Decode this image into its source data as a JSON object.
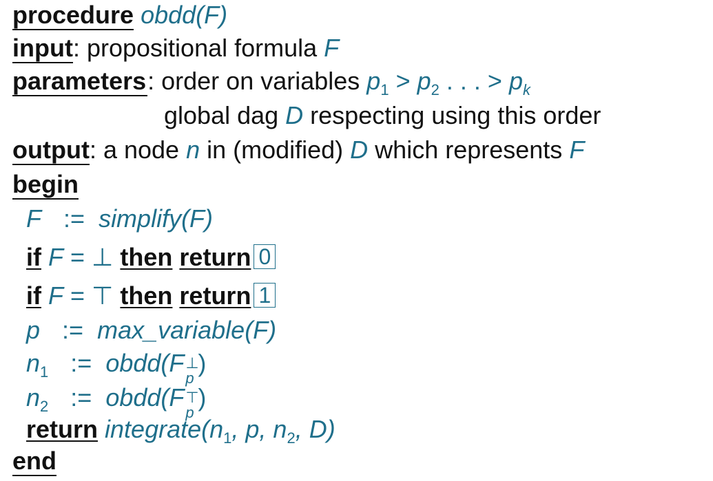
{
  "header": {
    "procedure_kw": "procedure",
    "procedure_name": "obdd(F)"
  },
  "input": {
    "label": "input",
    "text": ": propositional formula ",
    "var": "F"
  },
  "parameters": {
    "label": "parameters",
    "text": ": order on variables ",
    "p1": "p",
    "p1_sub": "1",
    "gt1": " > ",
    "p2": "p",
    "p2_sub": "2",
    "dots": " . . . > ",
    "pk": "p",
    "pk_sub": "k",
    "line2_a": "global dag ",
    "line2_D": "D",
    "line2_b": " respecting using this order"
  },
  "output": {
    "label": "output",
    "text_a": ": a node ",
    "n": "n",
    "text_b": " in (modified) ",
    "D": "D",
    "text_c": " which represents ",
    "F": "F"
  },
  "begin_kw": "begin",
  "end_kw": "end",
  "body": {
    "l1_lhs": "F",
    "assign": ":=",
    "l1_rhs": "simplify(F)",
    "if_kw": "if",
    "then_kw": "then",
    "return_kw": "return",
    "l2_cond_F": "F",
    "l2_cond_eq": " = ⊥ ",
    "l2_box": "0",
    "l3_cond_F": "F",
    "l3_cond_eq": " = ⊤ ",
    "l3_box": "1",
    "l4_lhs": "p",
    "l4_rhs": "max_variable(F)",
    "l5_lhs": "n",
    "l5_lhs_sub": "1",
    "l5_rhs_a": "obdd(F",
    "l5_sup": "⊥",
    "l5_sub": "p",
    "l5_rhs_b": ")",
    "l6_lhs": "n",
    "l6_lhs_sub": "2",
    "l6_rhs_a": "obdd(F",
    "l6_sup": "⊤",
    "l6_sub": "p",
    "l6_rhs_b": ")",
    "l7_call": "integrate(n",
    "l7_sub1": "1",
    "l7_mid": ", p, n",
    "l7_sub2": "2",
    "l7_end": ", D)"
  }
}
